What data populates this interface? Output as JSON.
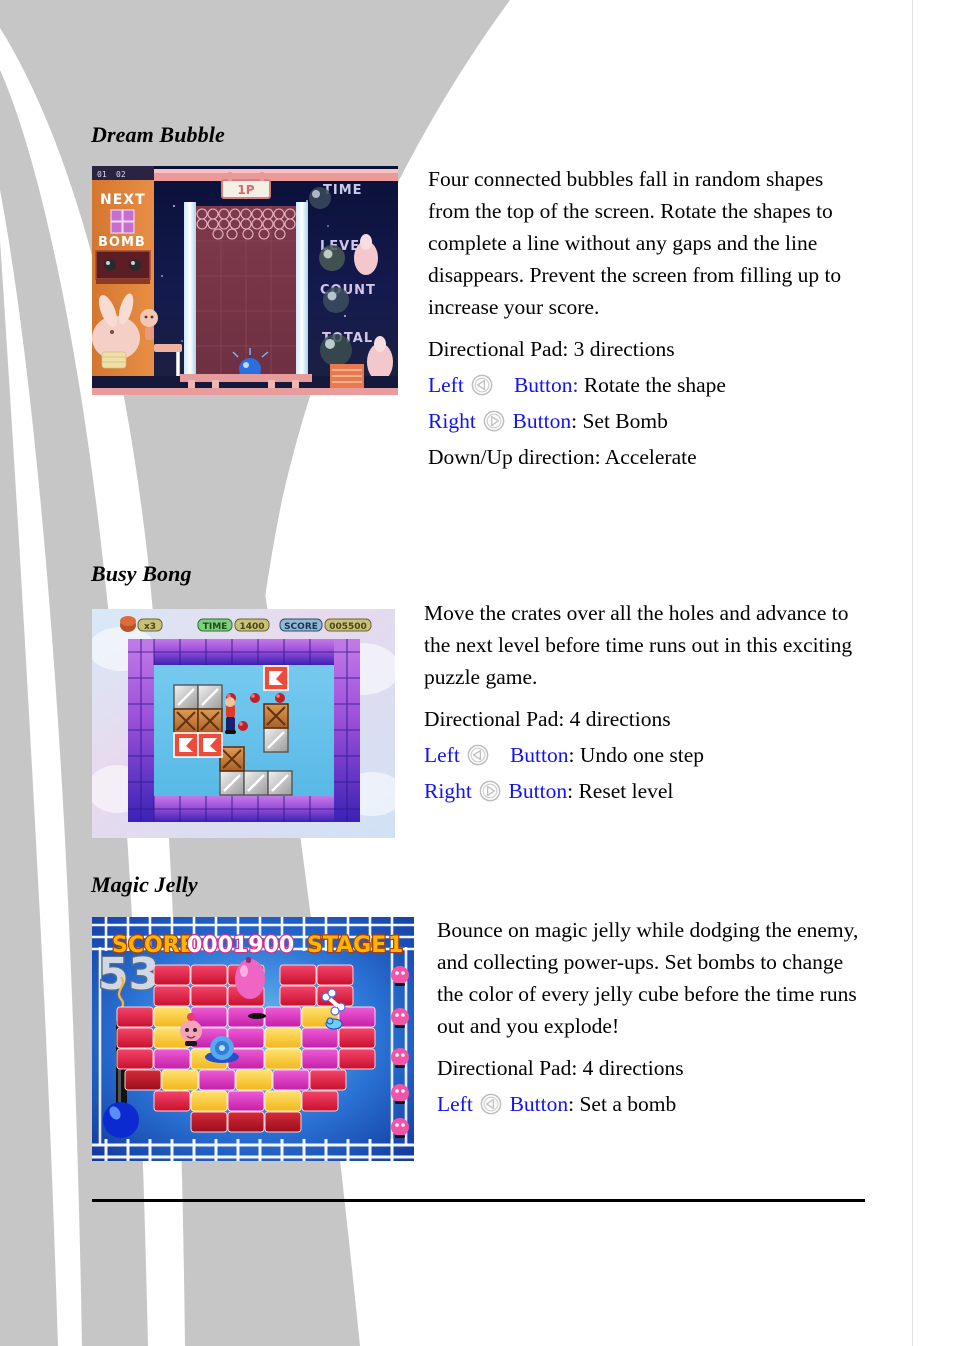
{
  "page": {
    "accent_blue": "#1313f0",
    "swoosh_gray": "#c6c6c6",
    "rule_color": "#000000"
  },
  "sections": [
    {
      "title": "Dream Bubble",
      "screenshot": {
        "name": "dream-bubble-screenshot",
        "labels": [
          "01",
          "02",
          "NEXT",
          "BOMB",
          "1P",
          "TIME",
          "LEVEL",
          "COUNT",
          "TOTAL"
        ]
      },
      "description": "Four connected bubbles fall in random shapes from the top of the screen. Rotate the shapes to complete a line without any gaps and the line disappears. Prevent the screen from filling up to increase your score.",
      "dpad": "Directional Pad: 3 directions",
      "controls": [
        {
          "side": "Left",
          "icon": "left-button-icon",
          "button": "Button:",
          "action": "Rotate the shape"
        },
        {
          "side": "Right",
          "icon": "right-button-icon",
          "button": "Button",
          "colon": ":",
          "action": "Set Bomb"
        }
      ],
      "extra": "Down/Up direction: Accelerate"
    },
    {
      "title": "Busy Bong",
      "screenshot": {
        "name": "busy-bong-screenshot",
        "labels": [
          "x3",
          "TIME",
          "1400",
          "SCORE",
          "005500"
        ]
      },
      "description": "Move the crates over all the holes and advance to the next level before time runs out in this exciting puzzle game.",
      "dpad": "Directional Pad: 4 directions",
      "controls": [
        {
          "side": "Left",
          "icon": "left-button-icon",
          "button": "Button",
          "colon": ":",
          "action": "Undo one step"
        },
        {
          "side": "Right",
          "icon": "right-button-icon",
          "button": "Button",
          "colon": ":",
          "action": "Reset level"
        }
      ],
      "extra": ""
    },
    {
      "title": "Magic Jelly",
      "screenshot": {
        "name": "magic-jelly-screenshot",
        "labels": [
          "SCORE",
          "0001900",
          "STAGE",
          "1",
          "53"
        ]
      },
      "description": "Bounce on magic jelly while dodging the enemy, and collecting power-ups. Set bombs to change the color of every jelly cube before the time runs out and you explode!",
      "dpad": "Directional Pad: 4 directions",
      "controls": [
        {
          "side": "Left",
          "icon": "left-button-icon",
          "button": "Button",
          "colon": ":",
          "action": "Set a bomb"
        }
      ],
      "extra": ""
    }
  ]
}
